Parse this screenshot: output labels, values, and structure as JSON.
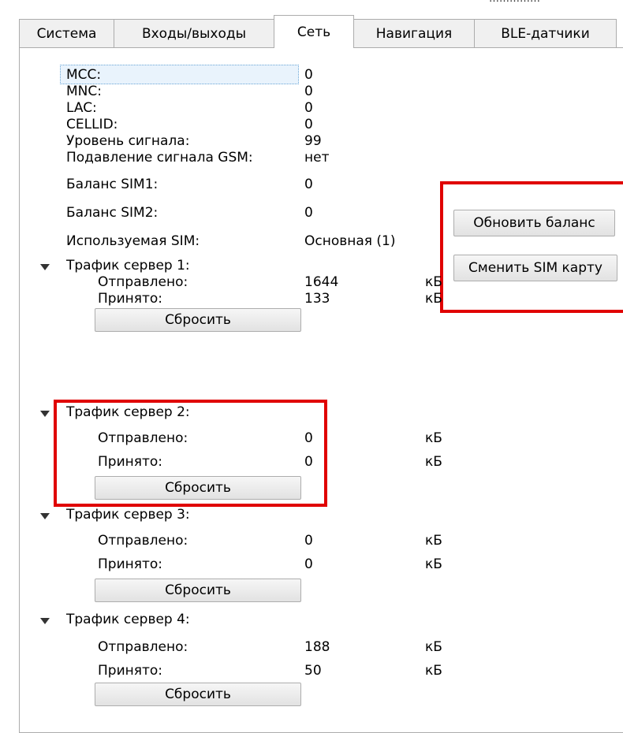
{
  "top_clip": "……………",
  "tabs": [
    "Система",
    "Входы/выходы",
    "Сеть",
    "Навигация",
    "BLE-датчики"
  ],
  "active_tab": "Сеть",
  "network": {
    "mcc": {
      "label": "MCC:",
      "value": "0"
    },
    "mnc": {
      "label": "MNC:",
      "value": "0"
    },
    "lac": {
      "label": "LAC:",
      "value": "0"
    },
    "cellid": {
      "label": "CELLID:",
      "value": "0"
    },
    "signal": {
      "label": "Уровень сигнала:",
      "value": "99"
    },
    "jamming": {
      "label": "Подавление сигнала GSM:",
      "value": "нет"
    },
    "balance1": {
      "label": "Баланс SIM1:",
      "value": "0"
    },
    "balance2": {
      "label": "Баланс SIM2:",
      "value": "0"
    },
    "active_sim": {
      "label": "Используемая SIM:",
      "value": "Основная (1)"
    }
  },
  "buttons": {
    "refresh_balance": "Обновить баланс",
    "switch_sim": "Сменить SIM карту"
  },
  "traffic": [
    {
      "title": "Трафик сервер 1:",
      "sent_label": "Отправлено:",
      "sent": "1644",
      "recv_label": "Принято:",
      "recv": "133",
      "unit": "кБ",
      "reset": "Сбросить"
    },
    {
      "title": "Трафик сервер 2:",
      "sent_label": "Отправлено:",
      "sent": "0",
      "recv_label": "Принято:",
      "recv": "0",
      "unit": "кБ",
      "reset": "Сбросить"
    },
    {
      "title": "Трафик сервер 3:",
      "sent_label": "Отправлено:",
      "sent": "0",
      "recv_label": "Принято:",
      "recv": "0",
      "unit": "кБ",
      "reset": "Сбросить"
    },
    {
      "title": "Трафик сервер 4:",
      "sent_label": "Отправлено:",
      "sent": "188",
      "recv_label": "Принято:",
      "recv": "50",
      "unit": "кБ",
      "reset": "Сбросить"
    }
  ],
  "colors": {
    "highlight": "#e00000",
    "border": "#acacac"
  }
}
